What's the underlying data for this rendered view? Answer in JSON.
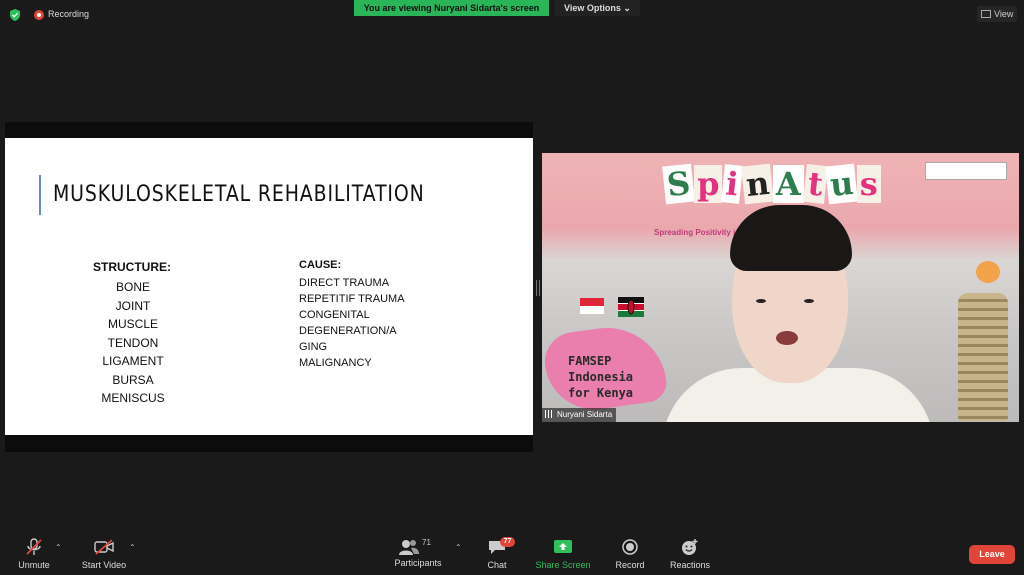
{
  "top_bar": {
    "recording_label": "Recording",
    "banner_text": "You are viewing Nuryani Sidarta's screen",
    "view_options_label": "View Options ⌄",
    "view_label": "View"
  },
  "slide": {
    "title": "MUSKULOSKELETAL REHABILITATION",
    "structure_heading": "STRUCTURE:",
    "structure_items": [
      "BONE",
      "JOINT",
      "MUSCLE",
      "TENDON",
      "LIGAMENT",
      "BURSA",
      "MENISCUS"
    ],
    "cause_heading": "CAUSE:",
    "cause_items": [
      "DIRECT TRAUMA",
      "REPETITIF TRAUMA",
      "CONGENITAL",
      "DEGENERATION/A",
      "GING",
      "MALIGNANCY"
    ]
  },
  "video": {
    "brand_letters": [
      "S",
      "p",
      "i",
      "n",
      "A",
      "t",
      "u",
      "s"
    ],
    "brand_colors": [
      "#2e7d4f",
      "#e3327f",
      "#e3327f",
      "#222222",
      "#2e7d4f",
      "#e3327f",
      "#2e7d4f",
      "#e3327f"
    ],
    "tagline": "Spreading Positivity i                                         kti University",
    "badge_lines": [
      "FAMSEP",
      "Indonesia",
      "for Kenya"
    ],
    "participant_name": "Nuryani Sidarta"
  },
  "toolbar": {
    "unmute": "Unmute",
    "start_video": "Start Video",
    "participants": "Participants",
    "participants_count": "71",
    "chat": "Chat",
    "chat_badge": "77",
    "share_screen": "Share Screen",
    "record": "Record",
    "reactions": "Reactions",
    "leave": "Leave"
  },
  "colors": {
    "accent_green": "#29b558",
    "danger_red": "#e0453a"
  }
}
